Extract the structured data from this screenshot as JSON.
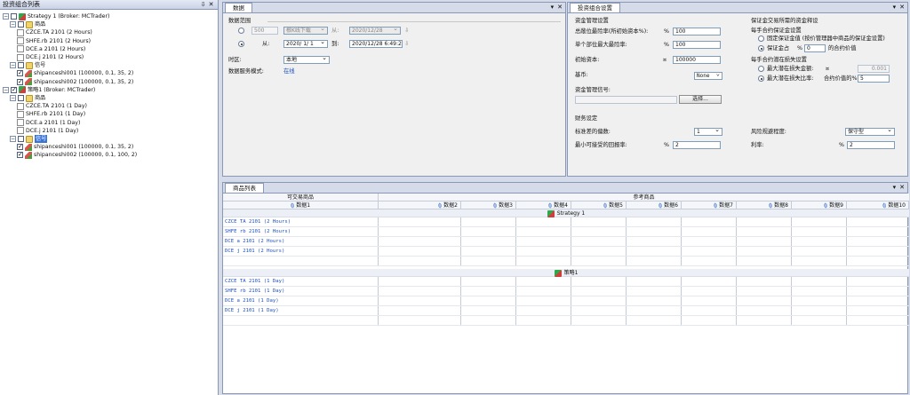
{
  "left_panel": {
    "title": "投资组合列表",
    "tree": [
      {
        "level": 0,
        "expander": "-",
        "checkbox": false,
        "icon": "strategy-icon",
        "label": "Strategy 1 (Broker: MCTrader)"
      },
      {
        "level": 1,
        "expander": "-",
        "checkbox": false,
        "icon": "folder-icon",
        "label": "商品"
      },
      {
        "level": 2,
        "icon": "document-icon",
        "label": "CZCE.TA 2101 (2 Hours)"
      },
      {
        "level": 2,
        "icon": "document-icon",
        "label": "SHFE.rb 2101 (2 Hours)"
      },
      {
        "level": 2,
        "icon": "document-icon",
        "label": "DCE.a 2101 (2 Hours)"
      },
      {
        "level": 2,
        "icon": "document-icon",
        "label": "DCE.j 2101 (2 Hours)"
      },
      {
        "level": 1,
        "expander": "-",
        "checkbox": false,
        "icon": "folder-icon",
        "label": "信号"
      },
      {
        "level": 2,
        "checkbox": true,
        "icon": "signal-icon",
        "label": "shipanceshi001 (100000, 0.1, 35, 2)"
      },
      {
        "level": 2,
        "checkbox": true,
        "icon": "signal-icon",
        "label": "shipanceshi002 (100000, 0.1, 35, 2)"
      },
      {
        "level": 0,
        "expander": "-",
        "checkbox": true,
        "icon": "strategy-icon",
        "label": "策略1 (Broker: MCTrader)"
      },
      {
        "level": 1,
        "expander": "-",
        "checkbox": false,
        "icon": "folder-icon",
        "label": "商品"
      },
      {
        "level": 2,
        "icon": "document-icon",
        "label": "CZCE.TA 2101 (1 Day)"
      },
      {
        "level": 2,
        "icon": "document-icon",
        "label": "SHFE.rb 2101 (1 Day)"
      },
      {
        "level": 2,
        "icon": "document-icon",
        "label": "DCE.a 2101 (1 Day)"
      },
      {
        "level": 2,
        "icon": "document-icon",
        "label": "DCE.j 2101 (1 Day)"
      },
      {
        "level": 1,
        "expander": "-",
        "checkbox": false,
        "icon": "folder-icon",
        "label": "信号",
        "selected": true
      },
      {
        "level": 2,
        "checkbox": true,
        "icon": "signal-icon",
        "label": "shipanceshi001 (100000, 0.1, 35, 2)"
      },
      {
        "level": 2,
        "checkbox": true,
        "icon": "signal-icon",
        "label": "shipanceshi002 (100000, 0.1, 100, 2)"
      }
    ]
  },
  "data_panel": {
    "tab": "数据",
    "section_title": "数据范围",
    "bars_value": "500",
    "bars_unit": "根K线下载",
    "from_short": "从:",
    "date_from_disabled": "2020/12/28",
    "from_label": "从:",
    "date_from": "2020/ 1/ 1",
    "to_label": "到:",
    "date_to": "2020/12/28  6:49:20",
    "timezone_label": "时区:",
    "timezone_value": "本地",
    "data_mode_label": "数据服务模式:",
    "data_mode_value": "在线"
  },
  "portfolio_panel": {
    "tab": "投资组合设置",
    "money_mgmt_title": "资金管理设置",
    "total_risk_label": "总敞位最险率(所初始资本%):",
    "total_risk_unit": "%",
    "total_risk_value": "100",
    "single_risk_label": "单个部位最大最险率:",
    "single_risk_unit": "%",
    "single_risk_value": "100",
    "initial_capital_label": "初始资本:",
    "initial_capital_unit": "¤",
    "initial_capital_value": "100000",
    "currency_label": "基币:",
    "currency_value": "None",
    "money_signal_label": "资金管理信号:",
    "select_button": "选择...",
    "margin_title": "保证金交易所需的资金释设",
    "per_contract_margin_title": "每手合约保证金设置",
    "fixed_margin_label": "固定保证金值 (按价管理器中商品的保证金设置)",
    "margin_pct_label": "保证金占",
    "margin_pct_unit": "%",
    "margin_pct_value": "0",
    "margin_pct_suffix": "的合约价值",
    "per_contract_loss_title": "每手合约潜在损失设置",
    "max_loss_amount_label": "最大潜在损失金额:",
    "max_loss_amount_unit": "¤",
    "max_loss_amount_value": "0.001",
    "max_loss_rate_label": "最大潜在损失比率:",
    "contract_value_label": "合约价值的%",
    "contract_value_value": "5",
    "financial_title": "财务设定",
    "std_dev_label": "标准差的偏数:",
    "std_dev_value": "1",
    "risk_level_label": "风险规避程度:",
    "risk_level_value": "保守型",
    "min_return_label": "最小可接受的回报率:",
    "min_return_unit": "%",
    "min_return_value": "2",
    "interest_label": "利率:",
    "interest_unit": "%",
    "interest_value": "2"
  },
  "instruments_panel": {
    "tab": "商品列表",
    "header_tradable": "可交易商品",
    "header_reference": "参考商品",
    "columns": [
      "数据1",
      "数据2",
      "数据3",
      "数据4",
      "数据5",
      "数据6",
      "数据7",
      "数据8",
      "数据9",
      "数据10"
    ],
    "groups": [
      {
        "name": "Strategy 1",
        "rows": [
          "CZCE TA 2101 (2 Hours)",
          "SHFE rb 2101 (2 Hours)",
          "DCE a 2101 (2 Hours)",
          "DCE j 2101 (2 Hours)"
        ]
      },
      {
        "name": "策略1",
        "rows": [
          "CZCE TA 2101 (1 Day)",
          "SHFE rb 2101 (1 Day)",
          "DCE a 2101 (1 Day)",
          "DCE j 2101 (1 Day)"
        ]
      }
    ]
  },
  "panel_controls": {
    "pin": "⇩",
    "close": "✕"
  }
}
